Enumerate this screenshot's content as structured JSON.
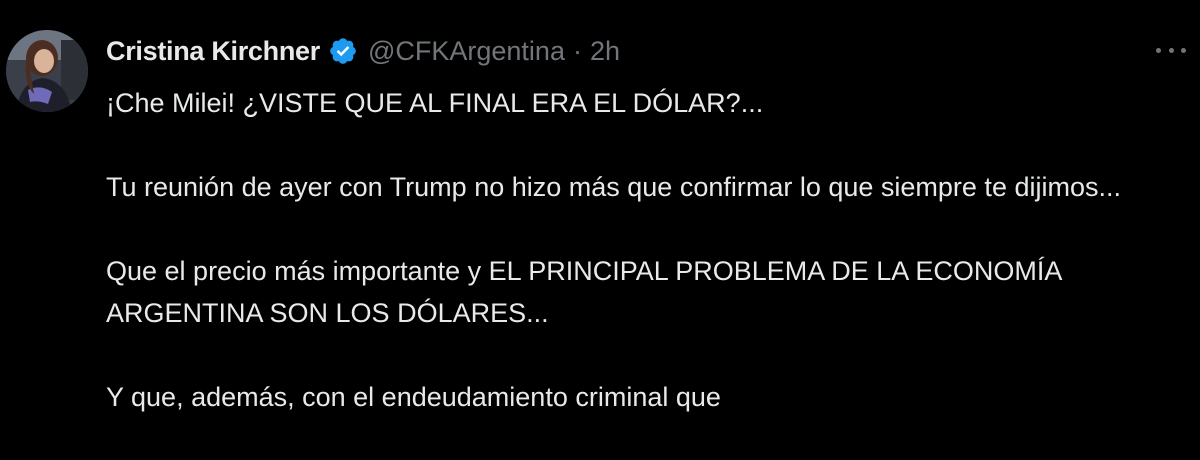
{
  "tweet": {
    "author": {
      "display_name": "Cristina Kirchner",
      "handle": "@CFKArgentina",
      "separator": "·",
      "timestamp": "2h",
      "verified_icon": "verified-badge-icon",
      "avatar": "avatar-photo"
    },
    "more_icon": "more-options-icon",
    "paragraphs": [
      "¡Che Milei! ¿VISTE QUE AL FINAL ERA EL DÓLAR?...",
      "Tu reunión de ayer con Trump no hizo más que confirmar lo que siempre te dijimos...",
      "Que el precio más importante y EL PRINCIPAL PROBLEMA DE LA ECONOMÍA ARGENTINA SON LOS DÓLARES...",
      "Y que, además, con el endeudamiento criminal que"
    ]
  },
  "colors": {
    "background": "#000000",
    "primary_text": "#e7e9ea",
    "secondary_text": "#71767b",
    "verified_blue": "#1d9bf0"
  }
}
